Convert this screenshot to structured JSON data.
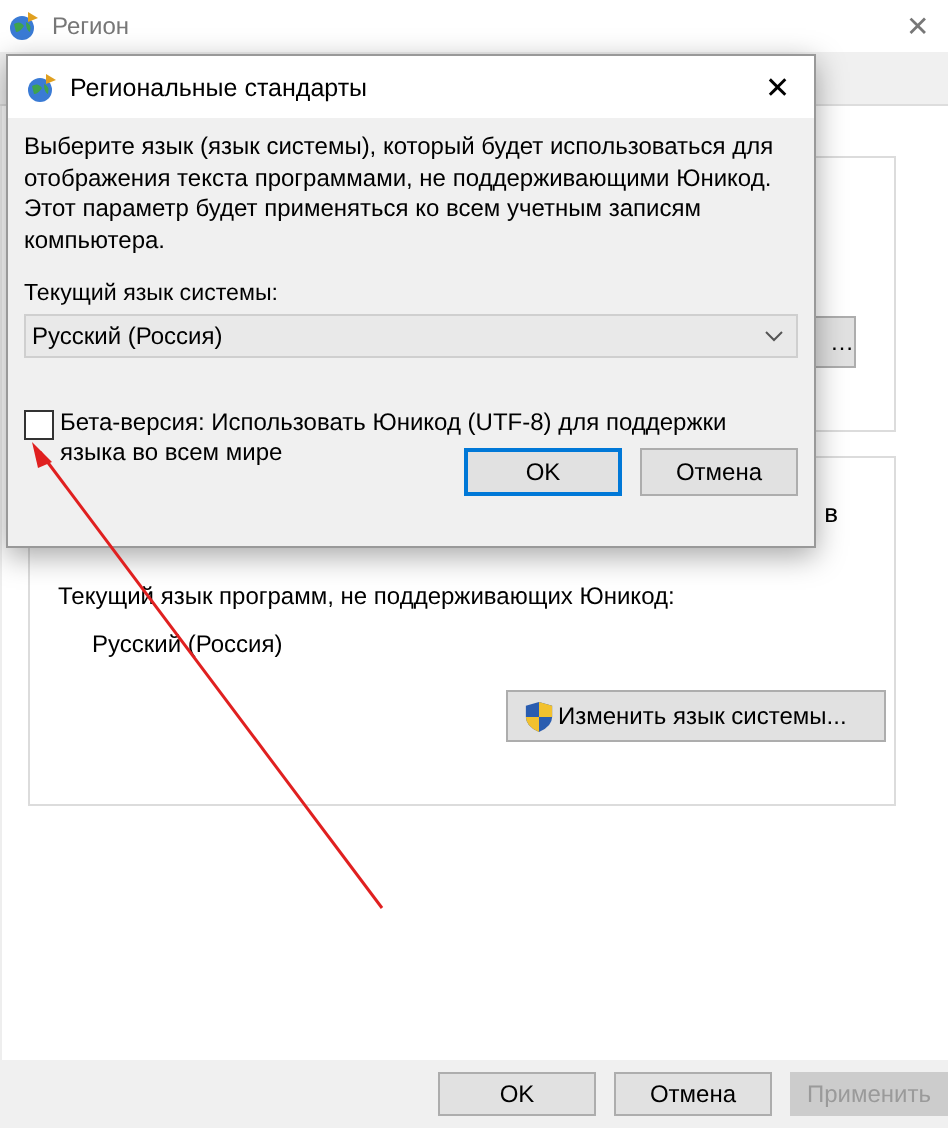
{
  "window": {
    "title": "Регион",
    "close": "✕"
  },
  "group_1": {
    "button_fragment": "…"
  },
  "group_2": {
    "text_fragment": "в",
    "label": "Текущий язык программ, не поддерживающих Юникод:",
    "value": "Русский (Россия)",
    "change_button": "Изменить язык системы..."
  },
  "buttons": [
    {
      "label": "OK",
      "disabled": false
    },
    {
      "label": "Отмена",
      "disabled": false
    },
    {
      "label": "Применить",
      "disabled": true
    }
  ],
  "dialog": {
    "title": "Региональные стандарты",
    "close": "✕",
    "description": "Выберите язык (язык системы), который будет использоваться для отображения текста программами, не поддерживающими Юникод. Этот параметр будет применяться ко всем учетным записям компьютера.",
    "select_label": "Текущий язык системы:",
    "select_value": "Русский (Россия)",
    "checkbox": {
      "label": "Бета-версия: Использовать Юникод (UTF-8) для поддержки языка во всем мире",
      "checked": false
    },
    "buttons": [
      {
        "label": "OK",
        "default": true
      },
      {
        "label": "Отмена",
        "default": false
      }
    ]
  },
  "annotation": {
    "kind": "arrow"
  }
}
